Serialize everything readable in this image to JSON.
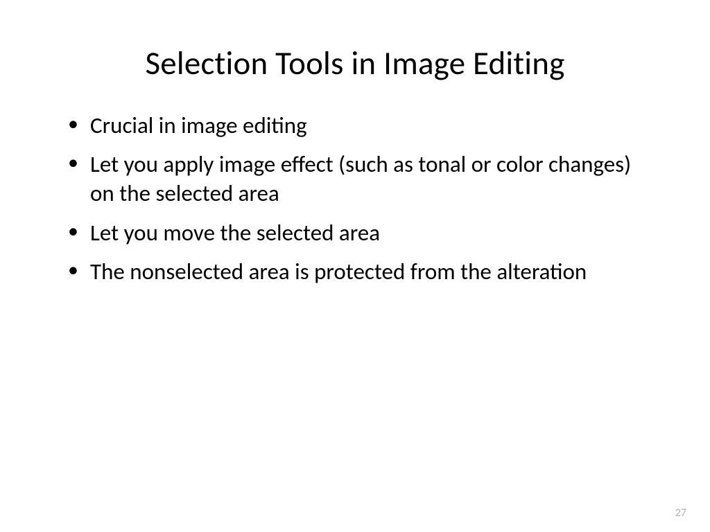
{
  "slide": {
    "title": "Selection Tools in Image Editing",
    "bullets": [
      "Crucial in image editing",
      "Let you apply image effect (such as tonal or color changes) on the selected area",
      "Let you move the selected area",
      "The nonselected area is protected from the alteration"
    ],
    "page_number": "27"
  }
}
